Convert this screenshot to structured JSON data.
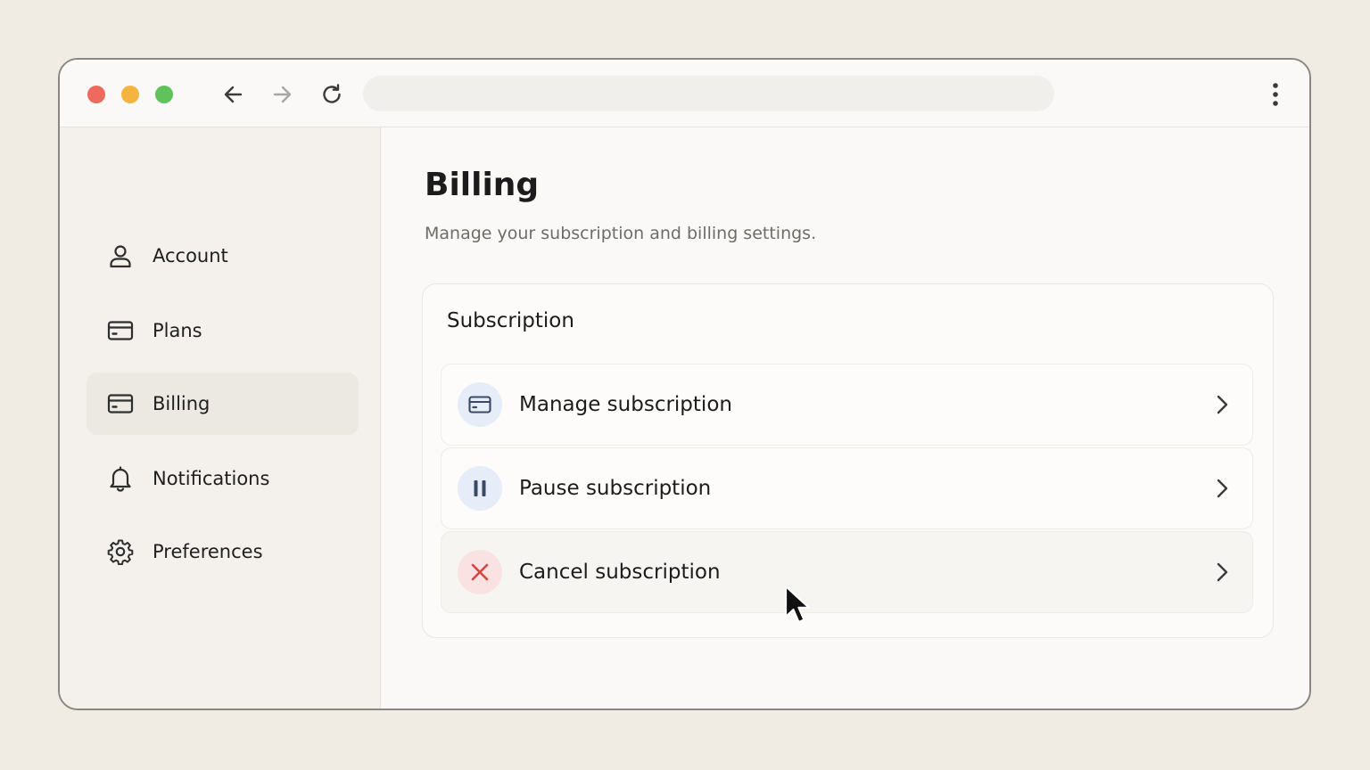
{
  "colors": {
    "close_dot": "#ee6a5e",
    "minimize_dot": "#f5b441",
    "zoom_dot": "#60c25a",
    "badge_blue": "#e6ecf8",
    "badge_red": "#fbe2e2",
    "danger": "#d64545"
  },
  "titlebar": {
    "back_icon": "arrow-left-icon",
    "forward_icon": "arrow-right-icon",
    "reload_icon": "reload-icon",
    "menu_icon": "kebab-menu-icon",
    "url": ""
  },
  "sidebar": {
    "items": [
      {
        "label": "Account",
        "icon": "user-icon",
        "active": false
      },
      {
        "label": "Plans",
        "icon": "credit-card-icon",
        "active": false
      },
      {
        "label": "Billing",
        "icon": "credit-card-icon",
        "active": true
      },
      {
        "label": "Notifications",
        "icon": "bell-icon",
        "active": false
      },
      {
        "label": "Preferences",
        "icon": "gear-icon",
        "active": false
      }
    ]
  },
  "main": {
    "title": "Billing",
    "subtitle": "Manage your subscription and billing settings.",
    "card": {
      "title": "Subscription",
      "rows": [
        {
          "label": "Manage subscription",
          "icon": "credit-card-icon"
        },
        {
          "label": "Pause subscription",
          "icon": "pause-icon"
        },
        {
          "label": "Cancel subscription",
          "icon": "close-icon"
        }
      ]
    }
  }
}
